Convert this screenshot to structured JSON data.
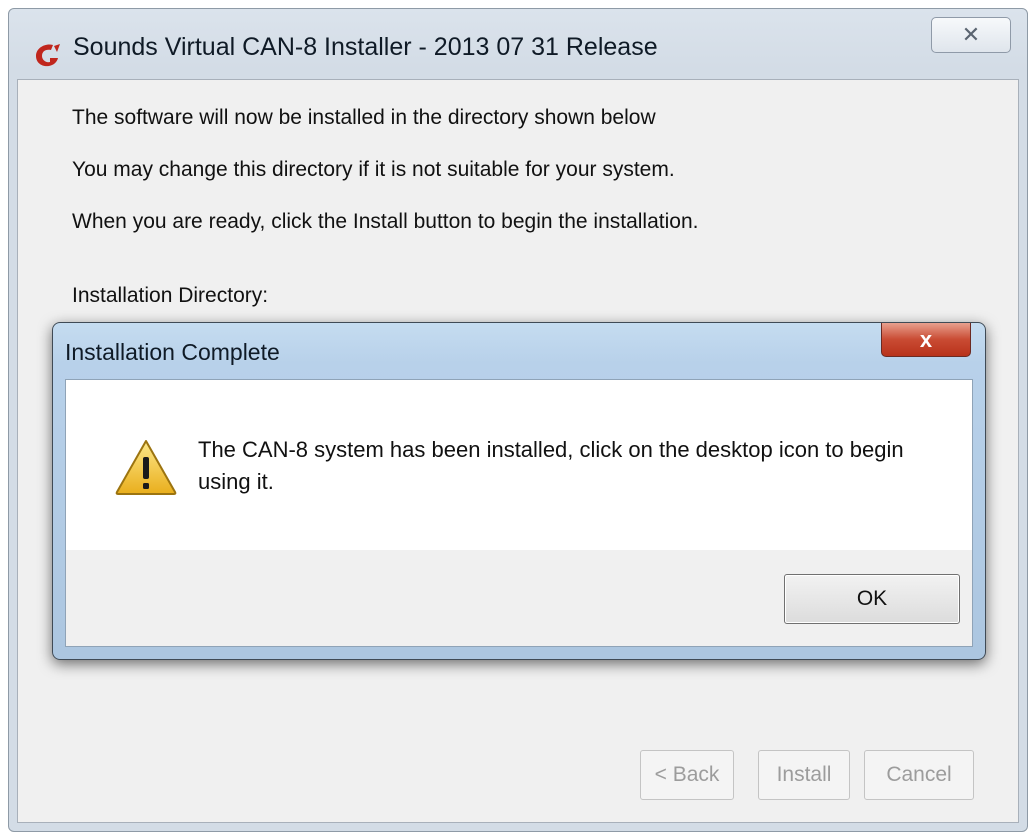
{
  "installer_window": {
    "title": "Sounds Virtual CAN-8 Installer - 2013 07 31 Release",
    "close_glyph": "✕",
    "lines": [
      "The software will now be installed in the directory shown below",
      "You may change this directory if it is not suitable for your system.",
      "When you are ready, click the Install button to begin the installation."
    ],
    "directory_label": "Installation Directory:",
    "buttons": {
      "back": "< Back",
      "install": "Install",
      "cancel": "Cancel"
    },
    "icon": "app-logo-icon"
  },
  "dialog": {
    "title": "Installation Complete",
    "close_glyph": "x",
    "icon": "warning-icon",
    "message": "The CAN-8 system has been installed, click on the desktop icon to begin using it.",
    "ok_label": "OK"
  },
  "colors": {
    "dialog_close": "#c94b33",
    "warning_yellow": "#f2c230"
  }
}
